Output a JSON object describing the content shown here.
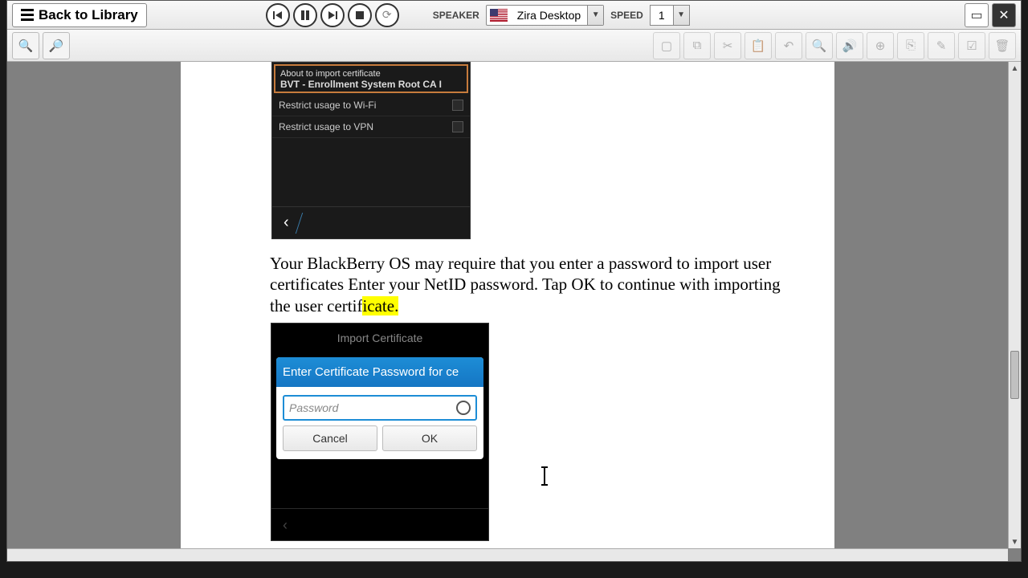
{
  "toolbar": {
    "back_label": "Back to Library",
    "speaker_label": "SPEAKER",
    "speaker_value": "Zira Desktop",
    "speed_label": "SPEED",
    "speed_value": "1"
  },
  "document": {
    "shot1": {
      "line1": "About to import certificate",
      "line2": "BVT - Enrollment System Root CA I",
      "restrict_wifi": "Restrict usage to Wi-Fi",
      "restrict_vpn": "Restrict usage to VPN"
    },
    "paragraph_pre": "Your BlackBerry OS may require that you enter a password to import user certificates Enter your NetID password. Tap OK to continue with importing the user certif",
    "paragraph_hl": "icate.",
    "shot2": {
      "title": "Import Certificate",
      "dialog_header": "Enter Certificate Password for ce",
      "placeholder": "Password",
      "cancel": "Cancel",
      "ok": "OK"
    }
  }
}
